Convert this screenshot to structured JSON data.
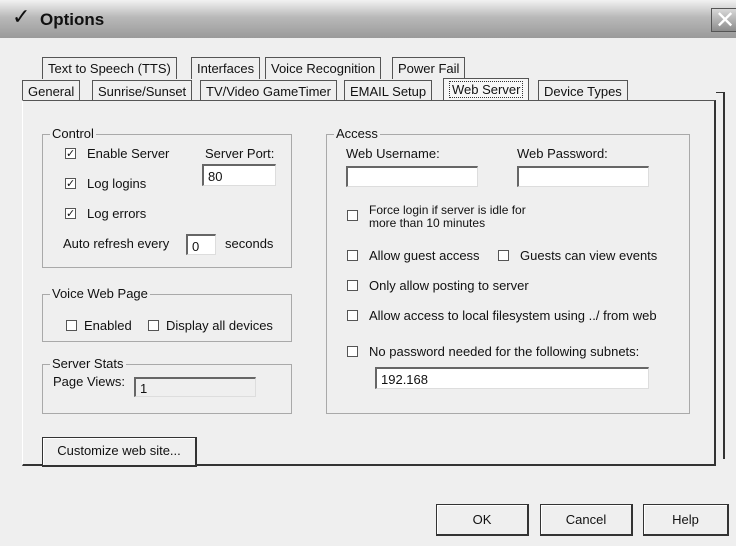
{
  "window": {
    "title": "Options",
    "title_icon": "checkmark-icon",
    "close_glyph": "✕"
  },
  "tabs_row1": [
    "Text to Speech (TTS)",
    "Interfaces",
    "Voice Recognition",
    "Power Fail"
  ],
  "tabs_row2": [
    "General",
    "Sunrise/Sunset",
    "TV/Video GameTimer",
    "EMAIL Setup",
    "Web Server",
    "Device Types"
  ],
  "active_tab": "Web Server",
  "control": {
    "legend": "Control",
    "enable_server": {
      "label": "Enable Server",
      "checked": true
    },
    "log_logins": {
      "label": "Log logins",
      "checked": true
    },
    "log_errors": {
      "label": "Log errors",
      "checked": true
    },
    "server_port_label": "Server Port:",
    "server_port_value": "80",
    "auto_refresh_prefix": "Auto refresh every",
    "auto_refresh_value": "0",
    "auto_refresh_suffix": "seconds"
  },
  "voice_web_page": {
    "legend": "Voice Web Page",
    "enabled": {
      "label": "Enabled",
      "checked": false
    },
    "display_all": {
      "label": "Display all devices",
      "checked": false
    }
  },
  "server_stats": {
    "legend": "Server Stats",
    "page_views_label": "Page Views:",
    "page_views_value": "1"
  },
  "customize_button": "Customize web site...",
  "access": {
    "legend": "Access",
    "web_username_label": "Web Username:",
    "web_username_value": "",
    "web_password_label": "Web Password:",
    "web_password_value": "",
    "force_login_line1": "Force login if server is idle for",
    "force_login_line2": "more than 10 minutes",
    "force_login_checked": false,
    "allow_guest": {
      "label": "Allow guest access",
      "checked": false
    },
    "guests_view_events": {
      "label": "Guests can view events",
      "checked": false
    },
    "only_posting": {
      "label": "Only allow posting to server",
      "checked": false
    },
    "local_filesystem": {
      "label": "Allow access to local filesystem using ../ from web",
      "checked": false
    },
    "no_password": {
      "label": "No password needed for the following subnets:",
      "checked": false
    },
    "subnets_value": "192.168"
  },
  "buttons": {
    "ok": "OK",
    "cancel": "Cancel",
    "help": "Help"
  },
  "check_glyph": "✓"
}
